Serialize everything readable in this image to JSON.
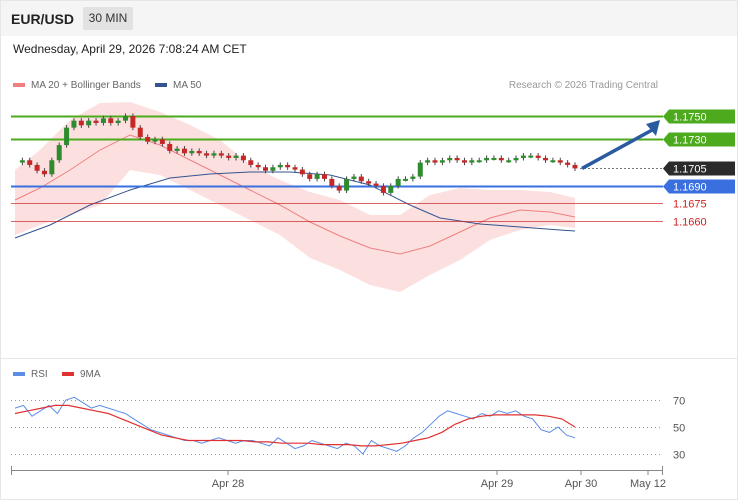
{
  "header": {
    "pair": "EUR/USD",
    "timeframe": "30 MIN",
    "datetime": "Wednesday, April 29, 2026 7:08:24 AM CET"
  },
  "legend": {
    "ma20_label": "MA 20 + Bollinger Bands",
    "ma50_label": "MA 50",
    "credit": "Research © 2026 Trading Central"
  },
  "rsi_legend": {
    "rsi_label": "RSI",
    "ma9_label": "9MA"
  },
  "colors": {
    "resistance": "#4caa1c",
    "support": "#3a6fe0",
    "secondary_support": "#cc2222",
    "candle_up": "#2e8b2e",
    "candle_down": "#c62828",
    "bollinger_fill": "#fbd6d6",
    "ma20": "#f08080",
    "ma50": "#34548f",
    "rsi": "#5b8de6",
    "rsi_ma9": "#e03030",
    "arrow": "#2a5aa0",
    "price_label": "#2b2b2b"
  },
  "chart_data": {
    "type": "candlestick",
    "instrument": "EUR/USD",
    "interval": "30 MIN",
    "price_ylim": [
      1.1655,
      1.1762
    ],
    "levels": [
      {
        "label": "1.1750",
        "value": 1.175,
        "kind": "resistance"
      },
      {
        "label": "1.1730",
        "value": 1.173,
        "kind": "resistance"
      },
      {
        "label": "1.1705",
        "value": 1.1705,
        "kind": "last_price"
      },
      {
        "label": "1.1690",
        "value": 1.169,
        "kind": "support"
      },
      {
        "label": "1.1675",
        "value": 1.1675,
        "kind": "secondary_support"
      },
      {
        "label": "1.1660",
        "value": 1.166,
        "kind": "secondary_support"
      }
    ],
    "x_axis_labels": [
      "Apr 28",
      "Apr 29",
      "Apr 30",
      "May 12"
    ],
    "rsi_ticks": [
      70,
      50,
      30
    ],
    "rsi_ylim": [
      20,
      80
    ],
    "projection_target": 1.175
  }
}
